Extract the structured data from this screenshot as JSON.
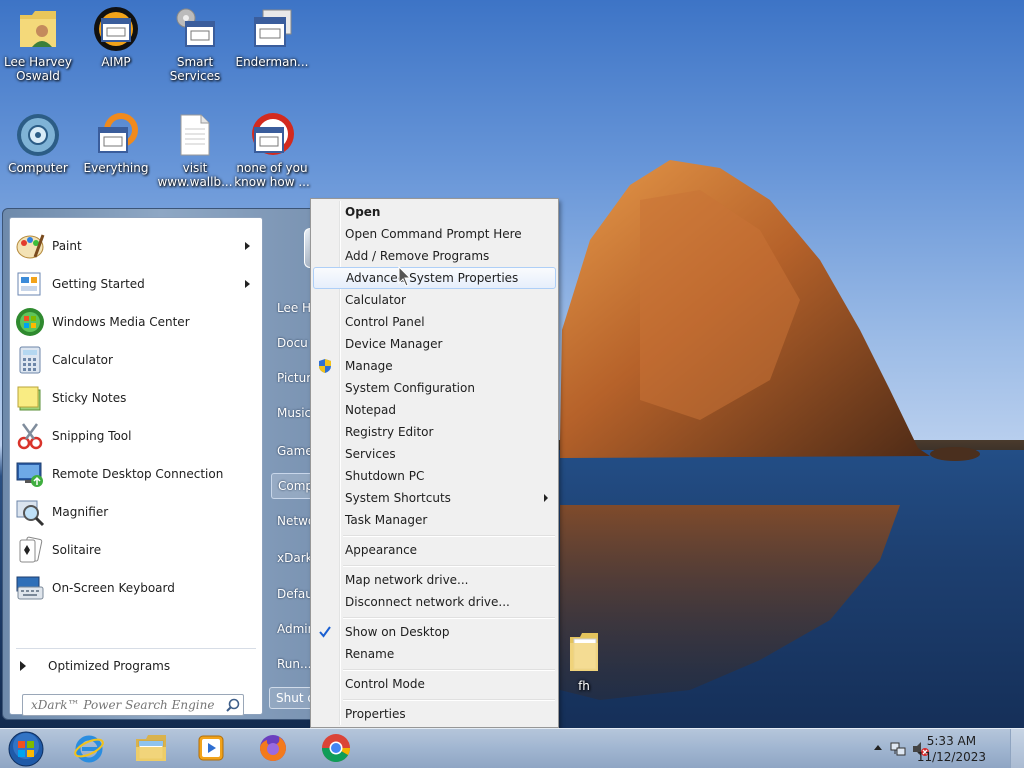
{
  "desktop": {
    "icons": [
      {
        "id": "lee",
        "label": "Lee Harvey\nOswald",
        "icon": "user-folder-icon"
      },
      {
        "id": "aimp",
        "label": "AIMP",
        "icon": "app-window-icon"
      },
      {
        "id": "smart",
        "label": "Smart\nServices",
        "icon": "app-window-icon"
      },
      {
        "id": "enderman",
        "label": "Enderman...",
        "icon": "app-window-icon"
      },
      {
        "id": "computer",
        "label": "Computer",
        "icon": "computer-icon"
      },
      {
        "id": "everything",
        "label": "Everything",
        "icon": "app-window-icon"
      },
      {
        "id": "visit",
        "label": "visit\nwww.wallb...",
        "icon": "text-file-icon"
      },
      {
        "id": "none",
        "label": "none of you\nknow how ...",
        "icon": "app-window-icon"
      },
      {
        "id": "fh",
        "label": "fh",
        "icon": "folder-icon"
      }
    ]
  },
  "start_menu": {
    "programs": [
      {
        "label": "Paint",
        "submenu": true
      },
      {
        "label": "Getting Started",
        "submenu": true
      },
      {
        "label": "Windows Media Center",
        "submenu": false
      },
      {
        "label": "Calculator",
        "submenu": false
      },
      {
        "label": "Sticky Notes",
        "submenu": false
      },
      {
        "label": "Snipping Tool",
        "submenu": false
      },
      {
        "label": "Remote Desktop Connection",
        "submenu": false
      },
      {
        "label": "Magnifier",
        "submenu": false
      },
      {
        "label": "Solitaire",
        "submenu": false
      },
      {
        "label": "On-Screen Keyboard",
        "submenu": false
      }
    ],
    "all_programs_label": "Optimized Programs",
    "search_placeholder": "xDark™ Power Search Engine",
    "right_items": [
      "Lee Ha",
      "Docu",
      "Picture",
      "Music",
      "Games",
      "Comp",
      "Netwo",
      "xDark",
      "Defaul",
      "Admin",
      "Run..."
    ],
    "right_highlight_index": 5,
    "shutdown_label": "Shut d"
  },
  "context_menu": {
    "items": [
      {
        "label": "Open",
        "bold": true
      },
      {
        "label": "Open Command Prompt Here"
      },
      {
        "label": "Add / Remove Programs"
      },
      {
        "label": "Advanced System Properties",
        "hover": true
      },
      {
        "label": "Calculator"
      },
      {
        "label": "Control Panel"
      },
      {
        "label": "Device Manager"
      },
      {
        "label": "Manage",
        "icon": "uac-shield-icon"
      },
      {
        "label": "System Configuration"
      },
      {
        "label": "Notepad"
      },
      {
        "label": "Registry Editor"
      },
      {
        "label": "Services"
      },
      {
        "label": "Shutdown PC"
      },
      {
        "label": "System Shortcuts",
        "submenu": true
      },
      {
        "label": "Task Manager"
      },
      {
        "separator": true
      },
      {
        "label": "Appearance"
      },
      {
        "separator": true
      },
      {
        "label": "Map network drive..."
      },
      {
        "label": "Disconnect network drive..."
      },
      {
        "separator": true
      },
      {
        "label": "Show on Desktop",
        "checked": true
      },
      {
        "label": "Rename"
      },
      {
        "separator": true
      },
      {
        "label": "Control Mode"
      },
      {
        "separator": true
      },
      {
        "label": "Properties"
      }
    ]
  },
  "taskbar": {
    "pinned": [
      "internet-explorer-icon",
      "file-explorer-icon",
      "media-player-icon",
      "firefox-icon",
      "chrome-icon"
    ],
    "clock_time": "5:33 AM",
    "clock_date": "11/12/2023"
  },
  "colors": {
    "menu_bg": "#f0f0f0",
    "hover_border": "#aecff7",
    "check_blue": "#1a5fd1"
  }
}
